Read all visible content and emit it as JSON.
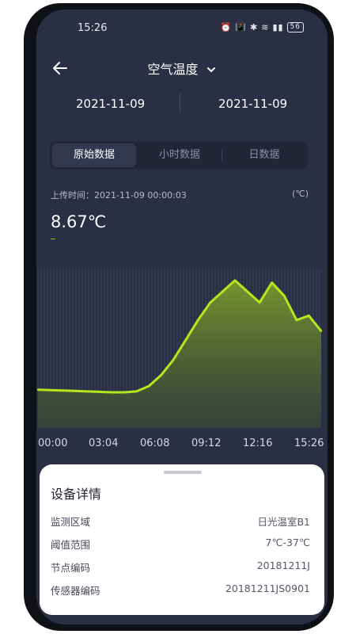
{
  "status_bar": {
    "time": "15:26",
    "battery": "56"
  },
  "header": {
    "title": "空气温度"
  },
  "date_range": {
    "start": "2021-11-09",
    "end": "2021-11-09"
  },
  "tabs": [
    {
      "label": "原始数据",
      "active": true
    },
    {
      "label": "小时数据",
      "active": false
    },
    {
      "label": "日数据",
      "active": false
    }
  ],
  "reading": {
    "upload_time": "上传时间：2021-11-09 00:00:03",
    "unit": "(℃)",
    "value": "8.67℃"
  },
  "chart_data": {
    "type": "area",
    "x_tick_labels": [
      "00:00",
      "03:04",
      "06:08",
      "09:12",
      "12:16",
      "15:26"
    ],
    "x": [
      "00:00",
      "01:00",
      "02:00",
      "03:00",
      "04:00",
      "05:00",
      "06:00",
      "07:00",
      "08:00",
      "08:30",
      "09:00",
      "09:30",
      "10:00",
      "10:30",
      "11:00",
      "11:30",
      "12:00",
      "12:30",
      "13:00",
      "13:30",
      "14:00",
      "14:30",
      "15:00",
      "15:26"
    ],
    "values": [
      8.7,
      8.6,
      8.5,
      8.4,
      8.3,
      8.2,
      8.1,
      8.1,
      8.3,
      9.5,
      12.0,
      15.5,
      20.0,
      24.5,
      28.5,
      31.0,
      33.5,
      31.0,
      28.5,
      33.0,
      30.0,
      24.5,
      25.5,
      22.0
    ],
    "ylim": [
      0,
      36
    ],
    "line_color": "#b5e61d",
    "fill_color": "#6b8a2a",
    "grid": true
  },
  "device_details": {
    "title": "设备详情",
    "rows": [
      {
        "label": "监测区域",
        "value": "日光温室B1"
      },
      {
        "label": "阈值范围",
        "value": "7℃-37℃"
      },
      {
        "label": "节点编码",
        "value": "20181211J"
      },
      {
        "label": "传感器编码",
        "value": "20181211JS0901"
      }
    ]
  }
}
